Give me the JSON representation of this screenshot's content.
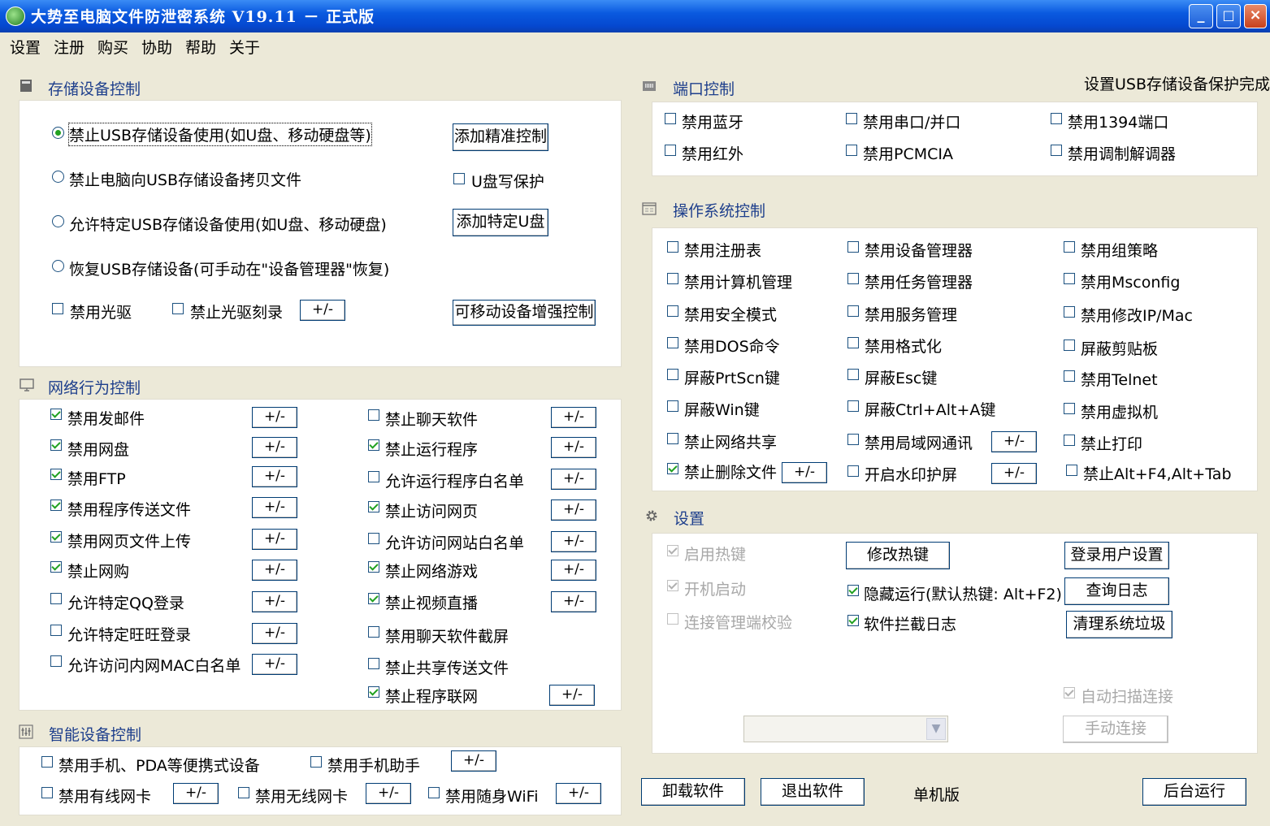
{
  "window": {
    "title": "大势至电脑文件防泄密系统 V19.11 － 正式版",
    "minimize": "_",
    "maximize": "□",
    "close": "×"
  },
  "menu": [
    "设置",
    "注册",
    "购买",
    "协助",
    "帮助",
    "关于"
  ],
  "storage": {
    "title": "存储设备控制",
    "radios": [
      {
        "label": "禁止USB存储设备使用(如U盘、移动硬盘等)",
        "selected": true
      },
      {
        "label": "禁止电脑向USB存储设备拷贝文件",
        "selected": false
      },
      {
        "label": "允许特定USB存储设备使用(如U盘、移动硬盘)",
        "selected": false
      },
      {
        "label": "恢复USB存储设备(可手动在\"设备管理器\"恢复)",
        "selected": false
      }
    ],
    "btn_precise": "添加精准控制",
    "usb_write_protect": "U盘写保护",
    "btn_add_usb": "添加特定U盘",
    "disable_cdrom": "禁用光驱",
    "disable_burn": "禁止光驱刻录",
    "pm": "+/-",
    "btn_removable": "可移动设备增强控制"
  },
  "network": {
    "title": "网络行为控制",
    "left": [
      {
        "label": "禁用发邮件",
        "checked": true
      },
      {
        "label": "禁用网盘",
        "checked": true
      },
      {
        "label": "禁用FTP",
        "checked": true
      },
      {
        "label": "禁用程序传送文件",
        "checked": true
      },
      {
        "label": "禁用网页文件上传",
        "checked": true
      },
      {
        "label": "禁止网购",
        "checked": true
      },
      {
        "label": "允许特定QQ登录",
        "checked": false
      },
      {
        "label": "允许特定旺旺登录",
        "checked": false
      },
      {
        "label": "允许访问内网MAC白名单",
        "checked": false
      }
    ],
    "right": [
      {
        "label": "禁止聊天软件",
        "checked": false,
        "pm": true
      },
      {
        "label": "禁止运行程序",
        "checked": true,
        "pm": true
      },
      {
        "label": "允许运行程序白名单",
        "checked": false,
        "pm": true
      },
      {
        "label": "禁止访问网页",
        "checked": true,
        "pm": true
      },
      {
        "label": "允许访问网站白名单",
        "checked": false,
        "pm": true
      },
      {
        "label": "禁止网络游戏",
        "checked": true,
        "pm": true
      },
      {
        "label": "禁止视频直播",
        "checked": true,
        "pm": true
      },
      {
        "label": "禁用聊天软件截屏",
        "checked": false,
        "pm": false
      },
      {
        "label": "禁止共享传送文件",
        "checked": false,
        "pm": false
      },
      {
        "label": "禁止程序联网",
        "checked": true,
        "pm": true
      }
    ]
  },
  "smart": {
    "title": "智能设备控制",
    "phone": "禁用手机、PDA等便携式设备",
    "phone_assistant": "禁用手机助手",
    "wired": "禁用有线网卡",
    "wireless": "禁用无线网卡",
    "wifi": "禁用随身WiFi"
  },
  "port": {
    "title": "端口控制",
    "status": "设置USB存储设备保护完成",
    "items": [
      "禁用蓝牙",
      "禁用串口/并口",
      "禁用1394端口",
      "禁用红外",
      "禁用PCMCIA",
      "禁用调制解调器"
    ]
  },
  "os": {
    "title": "操作系统控制",
    "col1": [
      {
        "label": "禁用注册表",
        "checked": false
      },
      {
        "label": "禁用计算机管理",
        "checked": false
      },
      {
        "label": "禁用安全模式",
        "checked": false
      },
      {
        "label": "禁用DOS命令",
        "checked": false
      },
      {
        "label": "屏蔽PrtScn键",
        "checked": false
      },
      {
        "label": "屏蔽Win键",
        "checked": false
      },
      {
        "label": "禁止网络共享",
        "checked": false
      },
      {
        "label": "禁止删除文件",
        "checked": true
      }
    ],
    "col2": [
      {
        "label": "禁用设备管理器",
        "checked": false
      },
      {
        "label": "禁用任务管理器",
        "checked": false
      },
      {
        "label": "禁用服务管理",
        "checked": false
      },
      {
        "label": "禁用格式化",
        "checked": false
      },
      {
        "label": "屏蔽Esc键",
        "checked": false
      },
      {
        "label": "屏蔽Ctrl+Alt+A键",
        "checked": false
      },
      {
        "label": "禁用局域网通讯",
        "checked": false
      },
      {
        "label": "开启水印护屏",
        "checked": false
      }
    ],
    "col3": [
      {
        "label": "禁用组策略",
        "checked": false
      },
      {
        "label": "禁用Msconfig",
        "checked": false
      },
      {
        "label": "禁用修改IP/Mac",
        "checked": false
      },
      {
        "label": "屏蔽剪贴板",
        "checked": false
      },
      {
        "label": "禁用Telnet",
        "checked": false
      },
      {
        "label": "禁用虚拟机",
        "checked": false
      },
      {
        "label": "禁止打印",
        "checked": false
      },
      {
        "label": "禁止Alt+F4,Alt+Tab",
        "checked": false
      }
    ]
  },
  "settings": {
    "title": "设置",
    "hotkey": "启用热键",
    "autostart": "开机启动",
    "verify": "连接管理端校验",
    "btn_hotkey": "修改热键",
    "hidden_run": "隐藏运行(默认热键: Alt+F2)",
    "intercept_log": "软件拦截日志",
    "btn_login": "登录用户设置",
    "btn_log": "查询日志",
    "btn_clean": "清理系统垃圾",
    "auto_scan": "自动扫描连接",
    "btn_manual": "手动连接"
  },
  "bottom": {
    "btn_uninstall": "卸载软件",
    "btn_exit": "退出软件",
    "mode": "单机版",
    "btn_background": "后台运行"
  }
}
